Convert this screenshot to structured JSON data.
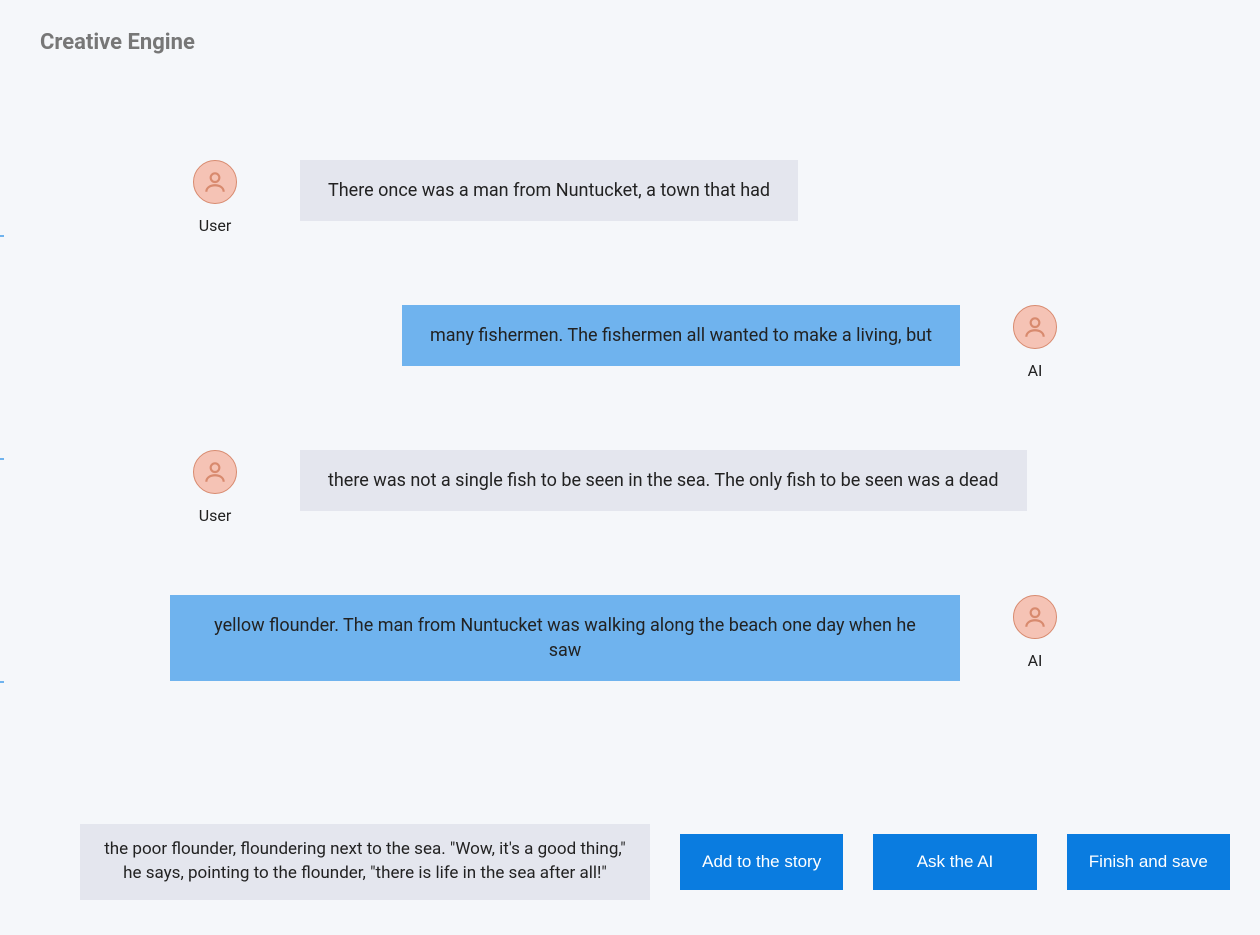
{
  "title": "Creative Engine",
  "labels": {
    "user": "User",
    "ai": "AI"
  },
  "messages": [
    {
      "role": "user",
      "text": "There once was a man from Nuntucket, a town that had"
    },
    {
      "role": "ai",
      "text": "many fishermen. The fishermen all wanted to make a living, but"
    },
    {
      "role": "user",
      "text": "there was not a single fish to be seen in the sea. The only fish to be seen was a dead"
    },
    {
      "role": "ai",
      "text": "yellow flounder. The man from Nuntucket was walking along the beach one day when he saw"
    }
  ],
  "input": {
    "value": "the poor flounder, floundering next to the sea. \"Wow, it's a good thing,\" he says, pointing to the flounder, \"there is life in the sea after all!\""
  },
  "buttons": {
    "add": "Add to the story",
    "ask": "Ask the AI",
    "finish": "Finish and save"
  }
}
